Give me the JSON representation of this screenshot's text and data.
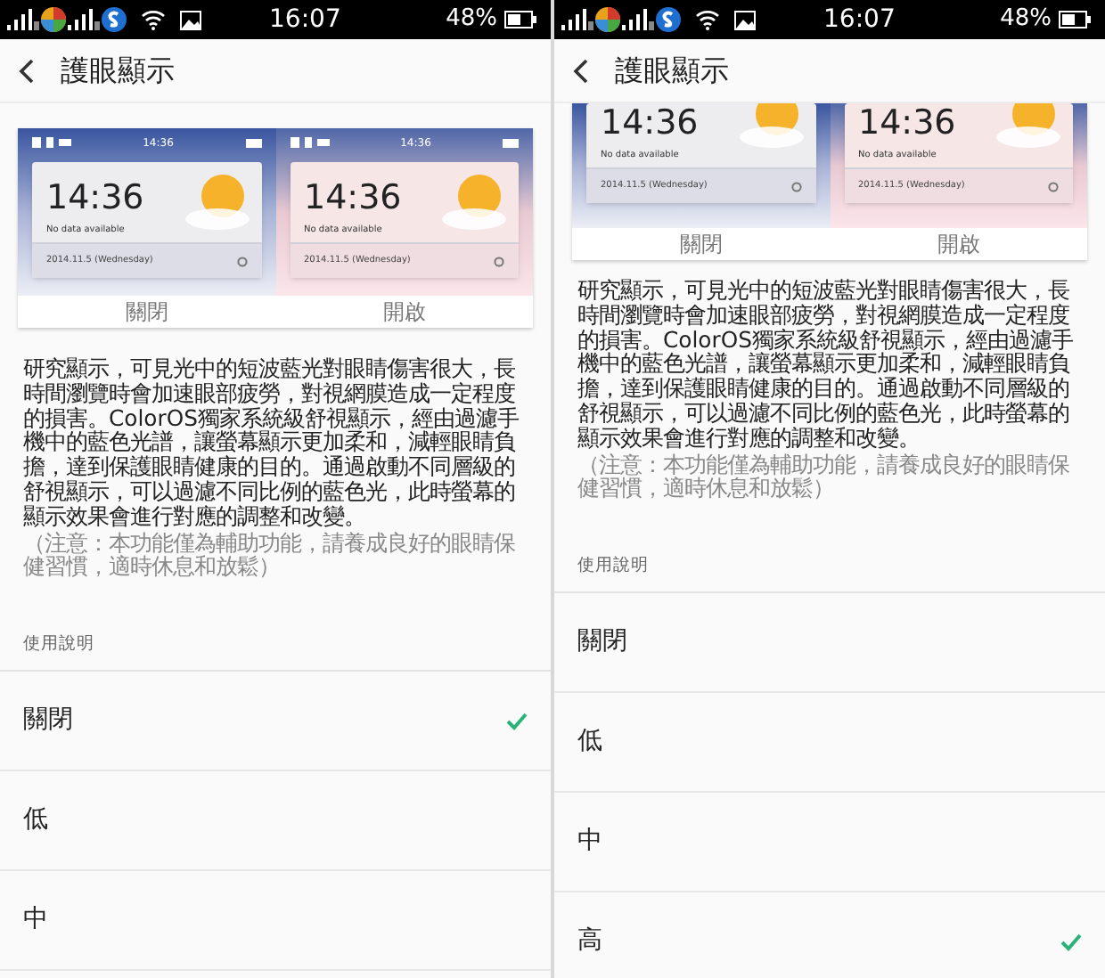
{
  "screens": [
    {
      "status_bar": {
        "time": "16:07",
        "battery": "48%"
      },
      "header": {
        "title": "護眼顯示"
      },
      "preview": {
        "cropped": false,
        "panels": [
          {
            "kind": "normal",
            "status_time": "14:36",
            "clock": "14:36",
            "no_data": "No data available",
            "date": "2014.11.5 (Wednesday)",
            "label": "關閉"
          },
          {
            "kind": "eye_care",
            "status_time": "14:36",
            "clock": "14:36",
            "no_data": "No data available",
            "date": "2014.11.5 (Wednesday)",
            "label": "開啟"
          }
        ]
      },
      "description": "研究顯示，可見光中的短波藍光對眼睛傷害很大，長時間瀏覽時會加速眼部疲勞，對視網膜造成一定程度的損害。ColorOS獨家系統級舒視顯示，經由過濾手機中的藍色光譜，讓螢幕顯示更加柔和，減輕眼睛負擔，達到保護眼睛健康的目的。通過啟動不同層級的舒視顯示，可以過濾不同比例的藍色光，此時螢幕的顯示效果會進行對應的調整和改變。",
      "note": "（注意：本功能僅為輔助功能，請養成良好的眼睛保健習慣，適時休息和放鬆）",
      "section_label": "使用說明",
      "options": [
        {
          "label": "關閉",
          "selected": true
        },
        {
          "label": "低",
          "selected": false
        },
        {
          "label": "中",
          "selected": false
        }
      ]
    },
    {
      "status_bar": {
        "time": "16:07",
        "battery": "48%"
      },
      "header": {
        "title": "護眼顯示"
      },
      "preview": {
        "cropped": true,
        "panels": [
          {
            "kind": "normal",
            "clock": "14:36",
            "no_data": "No data available",
            "date": "2014.11.5 (Wednesday)",
            "label": "關閉"
          },
          {
            "kind": "eye_care",
            "clock": "14:36",
            "no_data": "No data available",
            "date": "2014.11.5 (Wednesday)",
            "label": "開啟"
          }
        ]
      },
      "description": "研究顯示，可見光中的短波藍光對眼睛傷害很大，長時間瀏覽時會加速眼部疲勞，對視網膜造成一定程度的損害。ColorOS獨家系統級舒視顯示，經由過濾手機中的藍色光譜，讓螢幕顯示更加柔和，減輕眼睛負擔，達到保護眼睛健康的目的。通過啟動不同層級的舒視顯示，可以過濾不同比例的藍色光，此時螢幕的顯示效果會進行對應的調整和改變。",
      "note": "（注意：本功能僅為輔助功能，請養成良好的眼睛保健習慣，適時休息和放鬆）",
      "section_label": "使用說明",
      "options": [
        {
          "label": "關閉",
          "selected": false
        },
        {
          "label": "低",
          "selected": false
        },
        {
          "label": "中",
          "selected": false
        },
        {
          "label": "高",
          "selected": true
        }
      ]
    }
  ]
}
